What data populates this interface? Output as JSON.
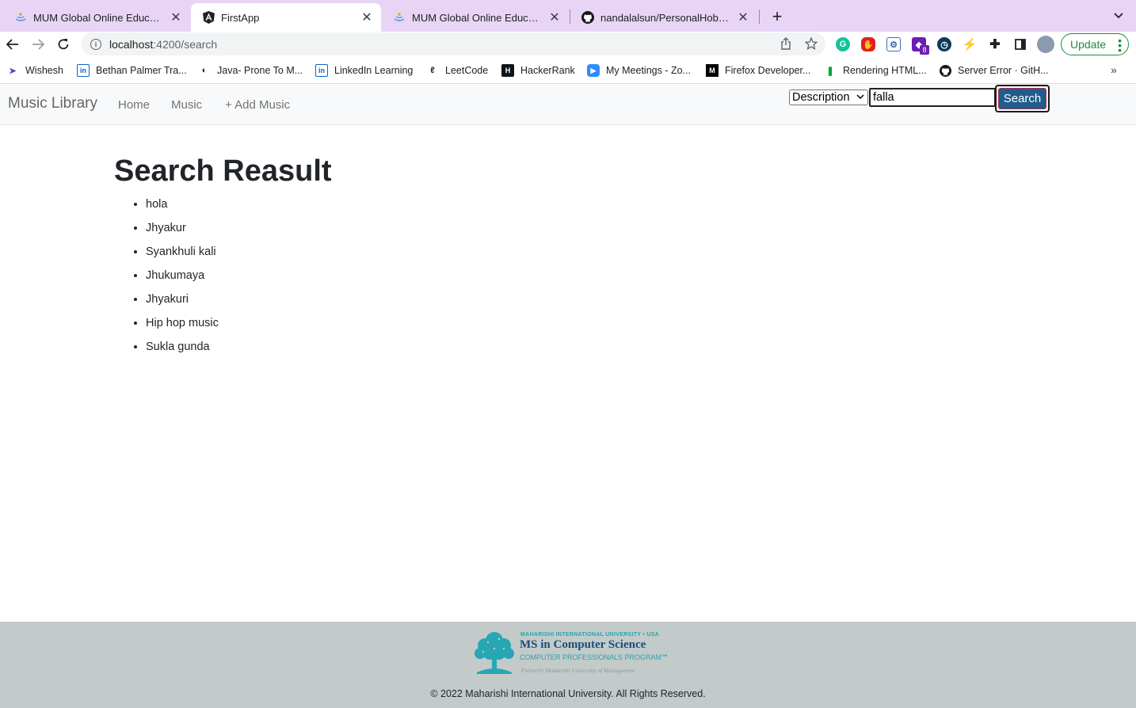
{
  "browser": {
    "tabs": [
      {
        "title": "MUM Global Online Education",
        "active": false,
        "favicon": "mum-icon"
      },
      {
        "title": "FirstApp",
        "active": true,
        "favicon": "angular-icon"
      },
      {
        "title": "MUM Global Online Education",
        "active": false,
        "favicon": "mum-icon"
      },
      {
        "title": "nandalalsun/PersonalHobbyFro",
        "active": false,
        "favicon": "github-icon"
      }
    ],
    "url_host": "localhost",
    "url_rest": ":4200/search",
    "update_label": "Update",
    "bookmarks": [
      {
        "label": "Wishesh",
        "icon": "send-icon"
      },
      {
        "label": "Bethan Palmer Tra...",
        "icon": "linkedin-icon"
      },
      {
        "label": "Java- Prone To M...",
        "icon": "globe-icon"
      },
      {
        "label": "LinkedIn Learning",
        "icon": "linkedin-icon"
      },
      {
        "label": "LeetCode",
        "icon": "leetcode-icon"
      },
      {
        "label": "HackerRank",
        "icon": "hackerrank-icon"
      },
      {
        "label": "My Meetings - Zo...",
        "icon": "zoom-icon"
      },
      {
        "label": "Firefox Developer...",
        "icon": "mdn-icon"
      },
      {
        "label": "Rendering HTML...",
        "icon": "evernote-icon"
      },
      {
        "label": "Server Error · GitH...",
        "icon": "github-icon"
      }
    ],
    "ext_badge": "8"
  },
  "navbar": {
    "brand": "Music Library",
    "links": [
      "Home",
      "Music",
      "+ Add Music"
    ],
    "filter_selected": "Description",
    "search_value": "falla",
    "search_button": "Search"
  },
  "main": {
    "title": "Search Reasult",
    "results": [
      "hola",
      "Jhyakur",
      "Syankhuli kali",
      "Jhukumaya",
      "Jhyakuri",
      "Hip hop music",
      "Sukla gunda"
    ]
  },
  "footer": {
    "logo_top": "MAHARISHI INTERNATIONAL UNIVERSITY • USA",
    "logo_title": "MS in Computer Science",
    "logo_sub": "COMPUTER PROFESSIONALS PROGRAM℠",
    "logo_formerly": "Formerly Maharishi University of Management",
    "copyright": "© 2022 Maharishi International University. All Rights Reserved."
  }
}
